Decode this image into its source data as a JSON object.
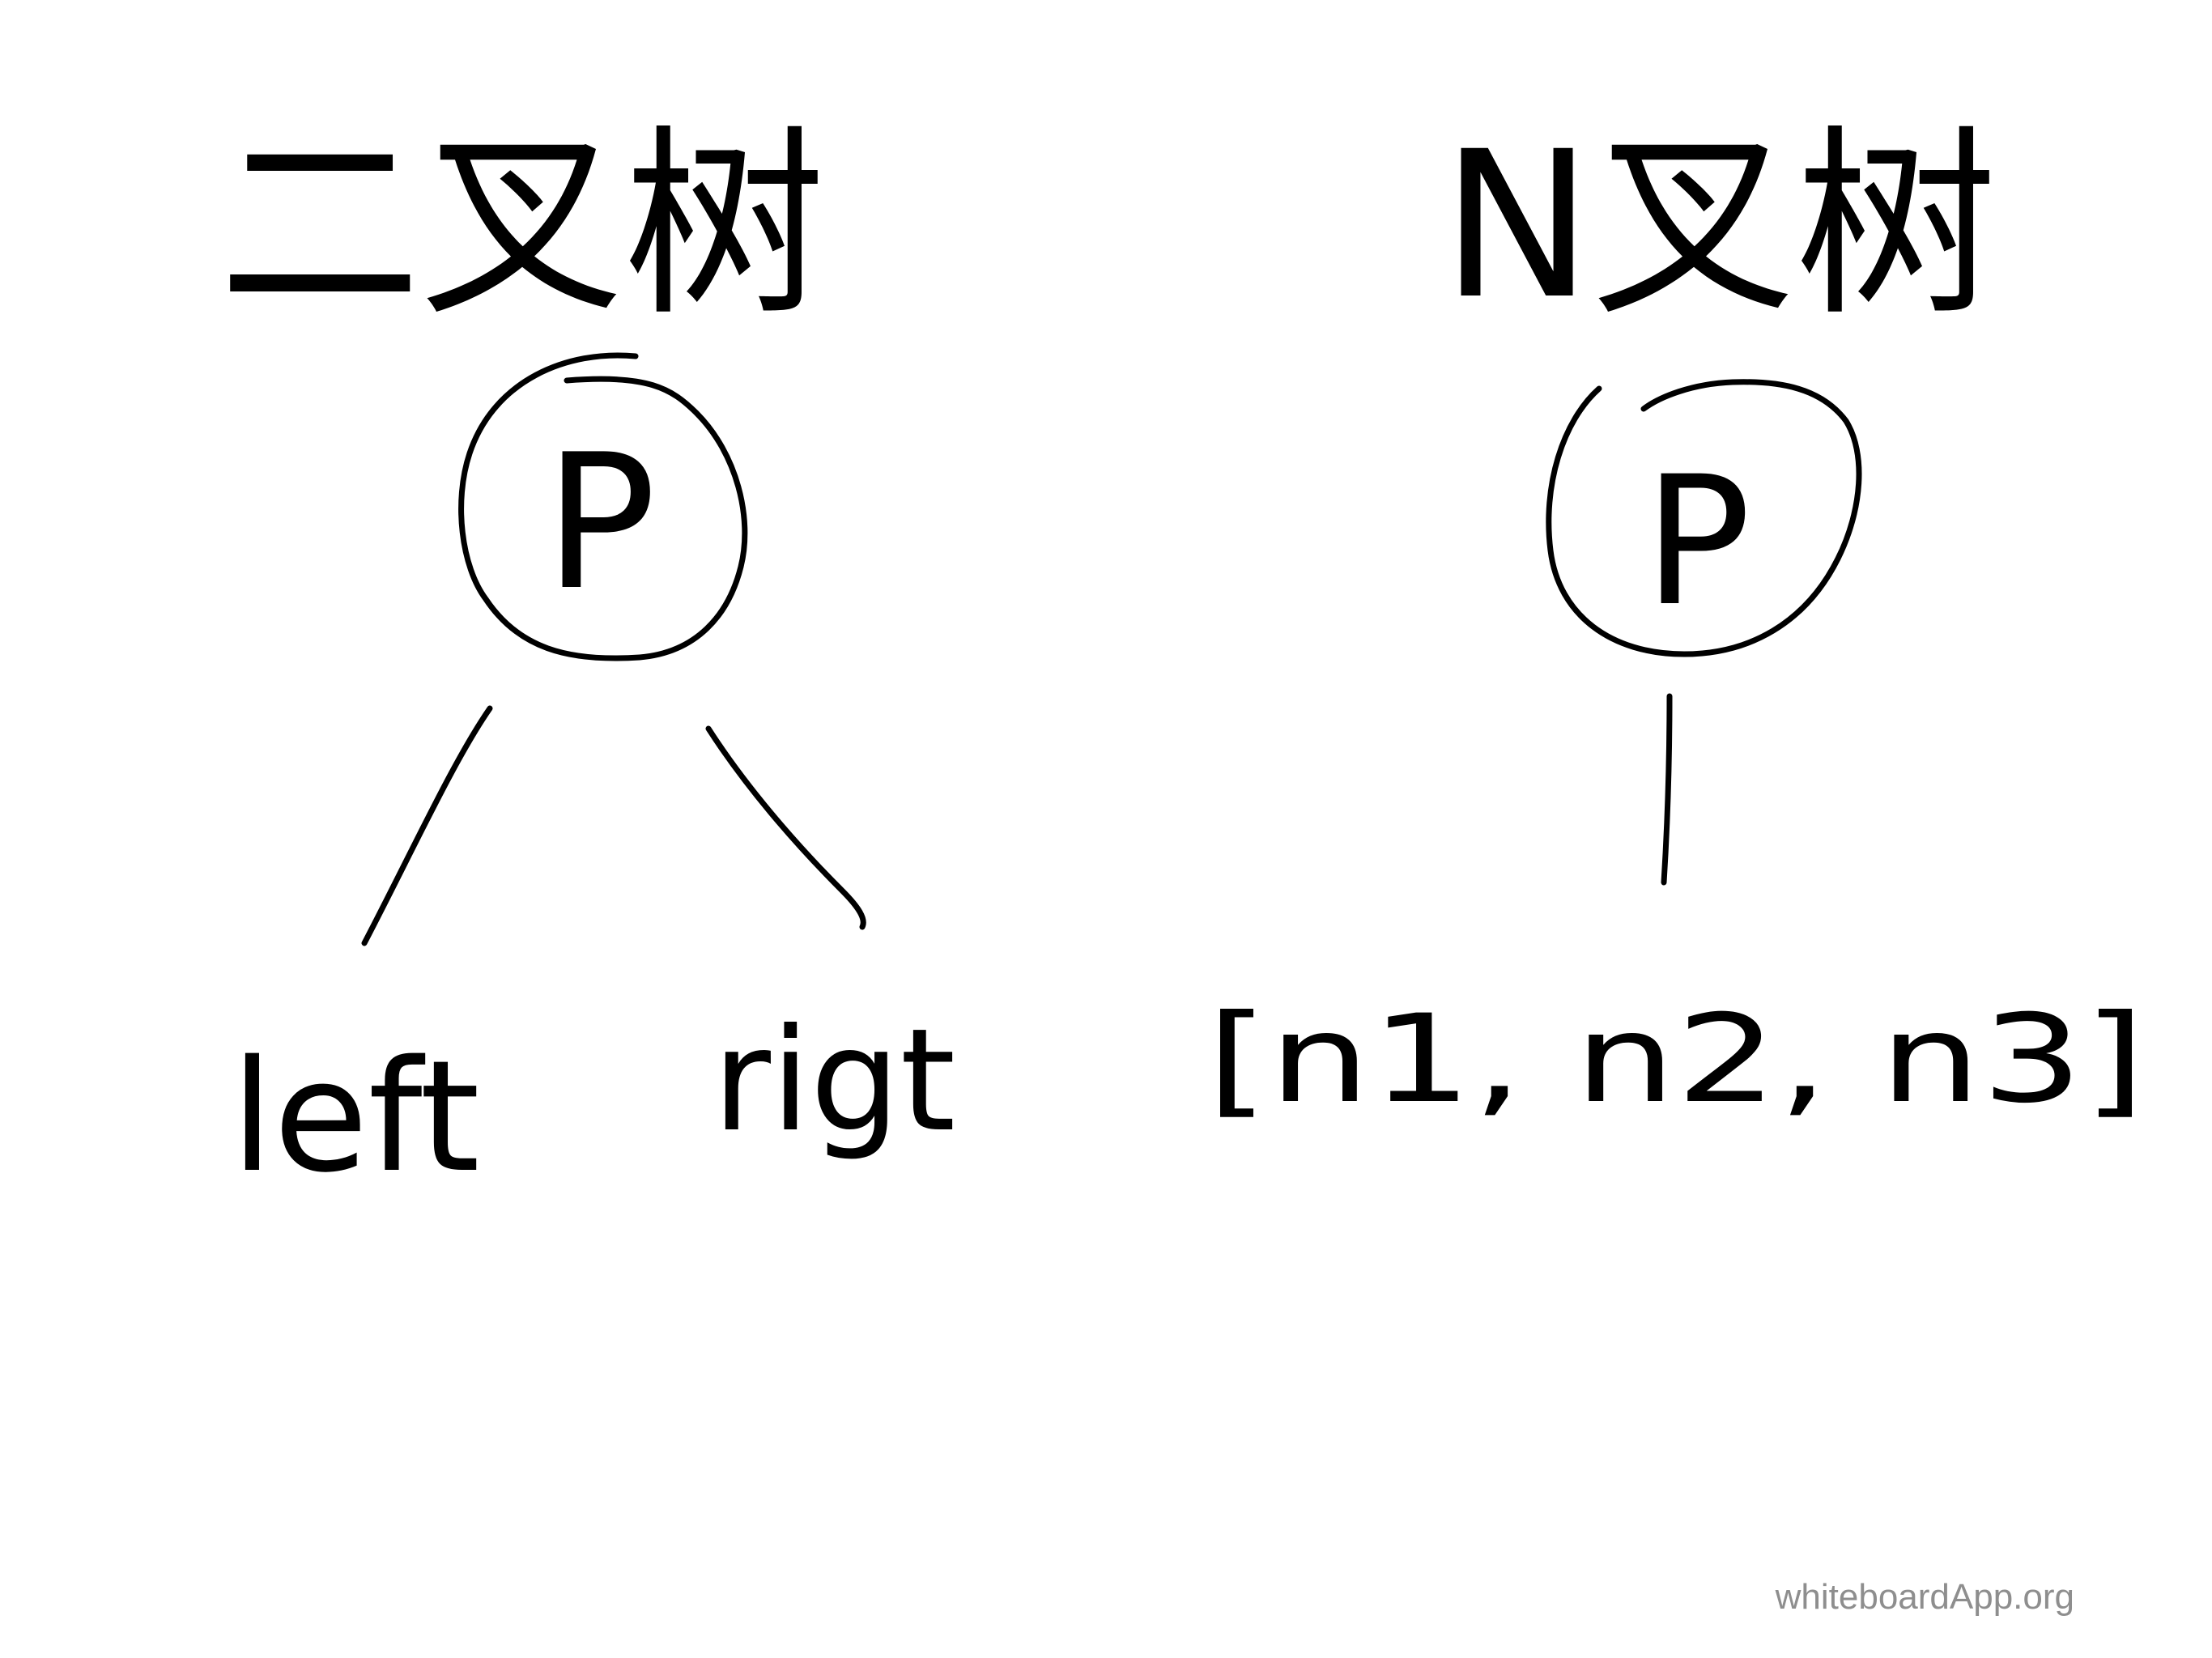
{
  "stroke_color": "#000000",
  "background_color": "#ffffff",
  "left_tree": {
    "title": "二叉树",
    "node_label": "P",
    "left_child": "left",
    "right_child": "rigt"
  },
  "right_tree": {
    "title": "N叉树",
    "node_label": "P",
    "children": "[n1, n2, n3]"
  },
  "watermark": "whiteboardApp.org"
}
